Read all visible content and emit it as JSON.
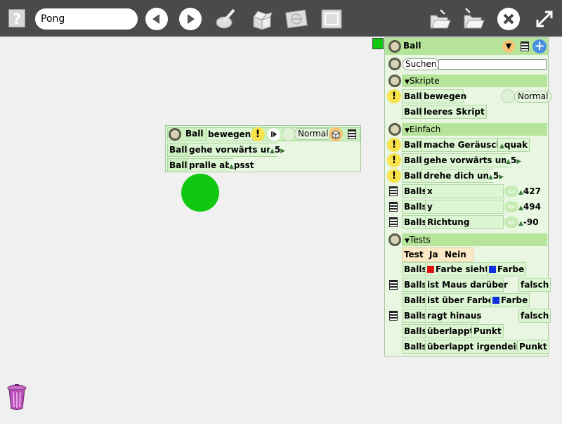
{
  "toolbar": {
    "help_label": "?",
    "project_name": "Pong"
  },
  "script": {
    "object": "Ball",
    "event": "bewegen",
    "tick_mode": "Normal",
    "rows": [
      {
        "object": "Ball",
        "command": "gehe vorwärts um",
        "value": "5"
      },
      {
        "object": "Ball",
        "command": "pralle ab",
        "value": "psst"
      }
    ]
  },
  "sprite": {
    "color": "#10c810"
  },
  "panel": {
    "title": "Ball",
    "search_label": "Suchen",
    "search_value": "",
    "sections": {
      "skripte": {
        "label": "Skripte",
        "rows": [
          {
            "object": "Ball",
            "command": "bewegen",
            "mode": "Normal"
          },
          {
            "object": "Ball",
            "command": "leeres Skript"
          }
        ]
      },
      "einfach": {
        "label": "Einfach",
        "rows": [
          {
            "object": "Ball",
            "command": "mache Geräusch",
            "value": "quak"
          },
          {
            "object": "Ball",
            "command": "gehe vorwärts um",
            "value": "5"
          },
          {
            "object": "Ball",
            "command": "drehe dich um",
            "value": "5"
          },
          {
            "object": "Balls",
            "command": "x",
            "value": "427"
          },
          {
            "object": "Balls",
            "command": "y",
            "value": "494"
          },
          {
            "object": "Balls",
            "command": "Richtung",
            "value": "-90"
          }
        ]
      },
      "tests": {
        "label": "Tests",
        "test_tile": {
          "test": "Test",
          "yes": "Ja",
          "no": "Nein"
        },
        "rows": [
          {
            "object": "Balls",
            "command": "Farbe sieht",
            "value": "Farbe"
          },
          {
            "object": "Balls",
            "command": "ist Maus darüber",
            "value": "falsch"
          },
          {
            "object": "Balls",
            "command": "ist über Farbe",
            "value": "Farbe"
          },
          {
            "object": "Balls",
            "command": "ragt hinaus",
            "value": "falsch"
          },
          {
            "object": "Balls",
            "command": "überlappt",
            "value": "Punkt"
          },
          {
            "object": "Balls",
            "command": "überlappt irgendein",
            "value": "Punkt"
          }
        ]
      }
    }
  },
  "colors": {
    "toolbar_bg": "#4a4a4a",
    "tile_green": "#ccf0c0",
    "header_green": "#b5e49a",
    "warning_yellow": "#f9e24a",
    "sprite_green": "#10c810",
    "swatch_red": "#e01010",
    "swatch_blue": "#1030e0"
  }
}
